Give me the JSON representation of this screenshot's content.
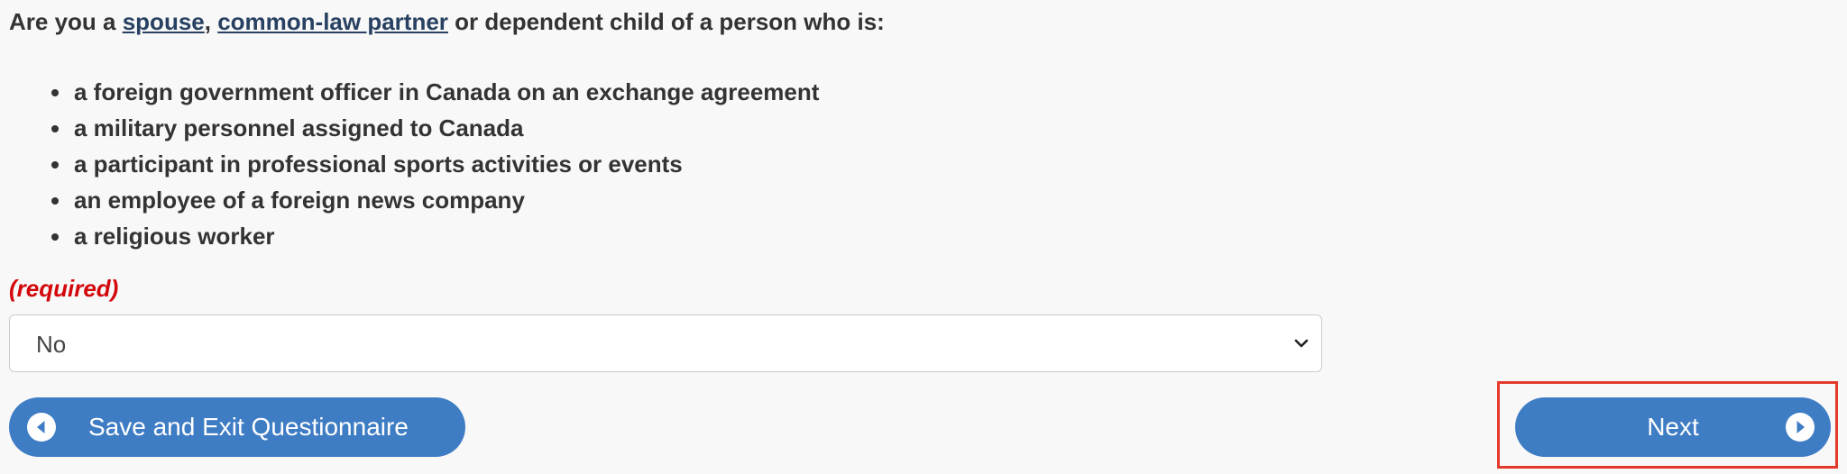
{
  "question": {
    "prefix": "Are you a ",
    "link_spouse": "spouse",
    "separator": ", ",
    "link_partner": "common-law partner",
    "suffix": " or dependent child of a person who is:"
  },
  "conditions": [
    "a foreign government officer in Canada on an exchange agreement",
    "a military personnel assigned to Canada",
    "a participant in professional sports activities or events",
    "an employee of a foreign news company",
    "a religious worker"
  ],
  "required_label": "(required)",
  "answer_select": {
    "value": "No"
  },
  "buttons": {
    "save_exit": "Save and Exit Questionnaire",
    "next": "Next"
  },
  "colors": {
    "button_bg": "#3e7cc4",
    "link": "#284162",
    "required": "#d3080c",
    "highlight": "#e43a2e"
  }
}
